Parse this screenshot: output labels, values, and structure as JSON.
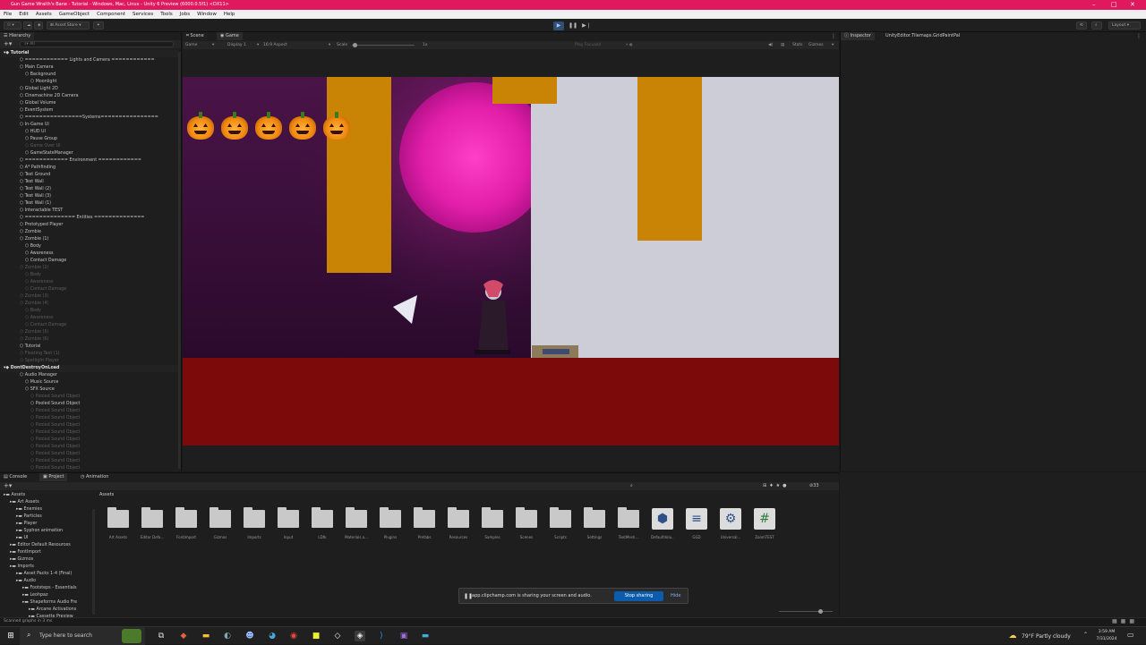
{
  "window": {
    "title": "Gun Game Wraith's Bane - Tutorial - Windows, Mac, Linux - Unity 6 Preview (6000.0.5f1) <DX11>"
  },
  "menu": [
    "File",
    "Edit",
    "Assets",
    "GameObject",
    "Component",
    "Services",
    "Tools",
    "Jobs",
    "Window",
    "Help"
  ],
  "toolbar": {
    "asset_store": "Asset Store",
    "layout": "Layout"
  },
  "hierarchy": {
    "tab": "Hierarchy",
    "search_placeholder": "All",
    "rows": [
      {
        "t": "Tutorial",
        "d": 0,
        "k": "scene"
      },
      {
        "t": "============ Lights and Camera ============",
        "d": 3,
        "k": ""
      },
      {
        "t": "Main Camera",
        "d": 3,
        "k": ""
      },
      {
        "t": "Background",
        "d": 4,
        "k": ""
      },
      {
        "t": "Moonlight",
        "d": 5,
        "k": ""
      },
      {
        "t": "Global Light 2D",
        "d": 3,
        "k": ""
      },
      {
        "t": "Cinemachine 2D Camera",
        "d": 3,
        "k": ""
      },
      {
        "t": "Global Volume",
        "d": 3,
        "k": ""
      },
      {
        "t": "EventSystem",
        "d": 3,
        "k": ""
      },
      {
        "t": "================Systems================",
        "d": 3,
        "k": ""
      },
      {
        "t": "In-Game UI",
        "d": 3,
        "k": ""
      },
      {
        "t": "HUD UI",
        "d": 4,
        "k": ""
      },
      {
        "t": "Pause Group",
        "d": 4,
        "k": ""
      },
      {
        "t": "Game Over UI",
        "d": 4,
        "k": "dim"
      },
      {
        "t": "GameStateManager",
        "d": 4,
        "k": ""
      },
      {
        "t": "============ Environment ============",
        "d": 3,
        "k": ""
      },
      {
        "t": "A* Pathfinding",
        "d": 3,
        "k": ""
      },
      {
        "t": "Test Ground",
        "d": 3,
        "k": ""
      },
      {
        "t": "Test Wall",
        "d": 3,
        "k": ""
      },
      {
        "t": "Test Wall (2)",
        "d": 3,
        "k": ""
      },
      {
        "t": "Test Wall (3)",
        "d": 3,
        "k": ""
      },
      {
        "t": "Test Wall (1)",
        "d": 3,
        "k": ""
      },
      {
        "t": "Interactable TEST",
        "d": 3,
        "k": ""
      },
      {
        "t": "============== Entities ==============",
        "d": 3,
        "k": ""
      },
      {
        "t": "Prototyped Player",
        "d": 3,
        "k": ""
      },
      {
        "t": "Zombie",
        "d": 3,
        "k": ""
      },
      {
        "t": "Zombie (1)",
        "d": 3,
        "k": ""
      },
      {
        "t": "Body",
        "d": 4,
        "k": ""
      },
      {
        "t": "Awareness",
        "d": 4,
        "k": ""
      },
      {
        "t": "Contact Damage",
        "d": 4,
        "k": ""
      },
      {
        "t": "Zombie (2)",
        "d": 3,
        "k": "dim"
      },
      {
        "t": "Body",
        "d": 4,
        "k": "dim"
      },
      {
        "t": "Awareness",
        "d": 4,
        "k": "dim"
      },
      {
        "t": "Contact Damage",
        "d": 4,
        "k": "dim"
      },
      {
        "t": "Zombie (3)",
        "d": 3,
        "k": "dim"
      },
      {
        "t": "Zombie (4)",
        "d": 3,
        "k": "dim"
      },
      {
        "t": "Body",
        "d": 4,
        "k": "dim"
      },
      {
        "t": "Awareness",
        "d": 4,
        "k": "dim"
      },
      {
        "t": "Contact Damage",
        "d": 4,
        "k": "dim"
      },
      {
        "t": "Zombie (5)",
        "d": 3,
        "k": "dim"
      },
      {
        "t": "Zombie (6)",
        "d": 3,
        "k": "dim"
      },
      {
        "t": "Tutorial",
        "d": 3,
        "k": ""
      },
      {
        "t": "Floating Text (1)",
        "d": 3,
        "k": "dim"
      },
      {
        "t": "Spotlight Player",
        "d": 3,
        "k": "dim"
      },
      {
        "t": "DontDestroyOnLoad",
        "d": 0,
        "k": "scene"
      },
      {
        "t": "Audio Manager",
        "d": 3,
        "k": ""
      },
      {
        "t": "Music Source",
        "d": 4,
        "k": ""
      },
      {
        "t": "SFX Source",
        "d": 4,
        "k": ""
      },
      {
        "t": "Pooled Sound Object",
        "d": 5,
        "k": "dim"
      },
      {
        "t": "Pooled Sound Object",
        "d": 5,
        "k": ""
      },
      {
        "t": "Pooled Sound Object",
        "d": 5,
        "k": "dim"
      },
      {
        "t": "Pooled Sound Object",
        "d": 5,
        "k": "dim"
      },
      {
        "t": "Pooled Sound Object",
        "d": 5,
        "k": "dim"
      },
      {
        "t": "Pooled Sound Object",
        "d": 5,
        "k": "dim"
      },
      {
        "t": "Pooled Sound Object",
        "d": 5,
        "k": "dim"
      },
      {
        "t": "Pooled Sound Object",
        "d": 5,
        "k": "dim"
      },
      {
        "t": "Pooled Sound Object",
        "d": 5,
        "k": "dim"
      },
      {
        "t": "Pooled Sound Object",
        "d": 5,
        "k": "dim"
      },
      {
        "t": "Pooled Sound Object",
        "d": 5,
        "k": "dim"
      }
    ]
  },
  "game": {
    "tabs": [
      "Scene",
      "Game"
    ],
    "mode": "Game",
    "display": "Display 1",
    "aspect": "16:9 Aspect",
    "scale_label": "Scale",
    "scale_value": "1x",
    "play_focused": "Play Focused",
    "stats": "Stats",
    "gizmos": "Gizmos"
  },
  "inspector": {
    "tab": "Inspector",
    "title": "UnityEditor.Tilemaps.GridPaintPal"
  },
  "bottom": {
    "tabs": [
      "Console",
      "Project",
      "Animation"
    ],
    "breadcrumb": "Assets",
    "count": "33",
    "tree": [
      {
        "t": "Assets",
        "d": 0
      },
      {
        "t": "Art Assets",
        "d": 1
      },
      {
        "t": "Enemies",
        "d": 2
      },
      {
        "t": "Particles",
        "d": 2
      },
      {
        "t": "Player",
        "d": 2
      },
      {
        "t": "Syphon animation",
        "d": 2
      },
      {
        "t": "UI",
        "d": 2
      },
      {
        "t": "Editor Default Resources",
        "d": 1
      },
      {
        "t": "FontImport",
        "d": 1
      },
      {
        "t": "Gizmos",
        "d": 1
      },
      {
        "t": "Imports",
        "d": 1
      },
      {
        "t": "Asset Packs 1-4 (Final)",
        "d": 2
      },
      {
        "t": "Audio",
        "d": 2
      },
      {
        "t": "Footsteps - Essentials",
        "d": 3
      },
      {
        "t": "Leohpaz",
        "d": 3
      },
      {
        "t": "Shapeforms Audio Fre",
        "d": 3
      },
      {
        "t": "Arcane Activations",
        "d": 4
      },
      {
        "t": "Cassette Preview",
        "d": 4
      }
    ],
    "assets": [
      {
        "name": "Art Assets",
        "kind": "folder"
      },
      {
        "name": "Editor Defa...",
        "kind": "folder"
      },
      {
        "name": "FontImport",
        "kind": "folder"
      },
      {
        "name": "Gizmos",
        "kind": "folder"
      },
      {
        "name": "Imports",
        "kind": "folder"
      },
      {
        "name": "Input",
        "kind": "folder"
      },
      {
        "name": "LDtk",
        "kind": "folder"
      },
      {
        "name": "Materials a...",
        "kind": "folder"
      },
      {
        "name": "Plugins",
        "kind": "folder"
      },
      {
        "name": "Prefabs",
        "kind": "folder"
      },
      {
        "name": "Resources",
        "kind": "folder"
      },
      {
        "name": "Samples",
        "kind": "folder"
      },
      {
        "name": "Scenes",
        "kind": "folder"
      },
      {
        "name": "Scripts",
        "kind": "folder"
      },
      {
        "name": "Settings",
        "kind": "folder"
      },
      {
        "name": "TextMesh...",
        "kind": "folder"
      },
      {
        "name": "DefaultVolu...",
        "kind": "cube"
      },
      {
        "name": "GGD",
        "kind": "doc"
      },
      {
        "name": "Universal...",
        "kind": "gear"
      },
      {
        "name": "ZoomTEST",
        "kind": "script"
      }
    ]
  },
  "share": {
    "text": "app.clipchamp.com is sharing your screen and audio.",
    "stop": "Stop sharing",
    "hide": "Hide"
  },
  "status": {
    "text": "Scanned graphs in 3 ms"
  },
  "taskbar": {
    "search": "Type here to search",
    "weather": "79°F  Partly cloudy",
    "time": "3:59 AM",
    "date": "7/31/2024"
  },
  "hud": {
    "lives": 5
  }
}
